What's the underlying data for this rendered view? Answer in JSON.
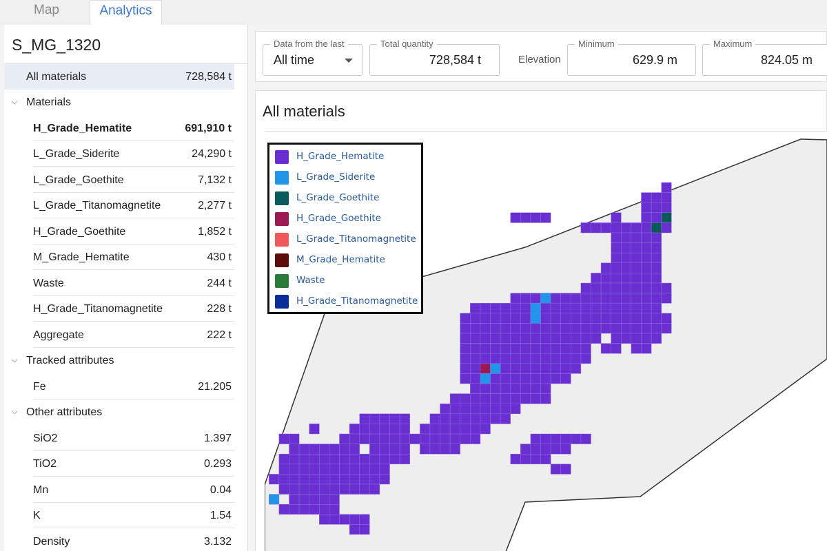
{
  "tabs": [
    {
      "label": "Map",
      "active": false
    },
    {
      "label": "Analytics",
      "active": true
    }
  ],
  "sidebar": {
    "title": "S_MG_1320",
    "all_materials": {
      "label": "All materials",
      "value": "728,584 t"
    },
    "materials_group": {
      "label": "Materials",
      "items": [
        {
          "label": "H_Grade_Hematite",
          "value": "691,910 t"
        },
        {
          "label": "L_Grade_Siderite",
          "value": "24,290 t"
        },
        {
          "label": "L_Grade_Goethite",
          "value": "7,132 t"
        },
        {
          "label": "L_Grade_Titanomagnetite",
          "value": "2,277 t"
        },
        {
          "label": "H_Grade_Goethite",
          "value": "1,852 t"
        },
        {
          "label": "M_Grade_Hematite",
          "value": "430 t"
        },
        {
          "label": "Waste",
          "value": "244 t"
        },
        {
          "label": "H_Grade_Titanomagnetite",
          "value": "228 t"
        },
        {
          "label": "Aggregate",
          "value": "222 t"
        }
      ]
    },
    "tracked_group": {
      "label": "Tracked attributes",
      "items": [
        {
          "label": "Fe",
          "value": "21.205"
        }
      ]
    },
    "other_group": {
      "label": "Other attributes",
      "items": [
        {
          "label": "SiO2",
          "value": "1.397"
        },
        {
          "label": "TiO2",
          "value": "0.293"
        },
        {
          "label": "Mn",
          "value": "0.04"
        },
        {
          "label": "K",
          "value": "1.54"
        },
        {
          "label": "Density",
          "value": "3.132"
        }
      ]
    }
  },
  "filters": {
    "data_from": {
      "legend": "Data from the last",
      "value": "All time"
    },
    "total_quantity": {
      "legend": "Total quantity",
      "value": "728,584 t"
    },
    "elevation_label": "Elevation",
    "minimum": {
      "legend": "Minimum",
      "value": "629.9 m"
    },
    "maximum": {
      "legend": "Maximum",
      "value": "824.05 m"
    }
  },
  "panel": {
    "title": "All materials"
  },
  "legend": [
    {
      "label": "H_Grade_Hematite",
      "color": "#6a2fd0"
    },
    {
      "label": "L_Grade_Siderite",
      "color": "#2196e8"
    },
    {
      "label": "L_Grade_Goethite",
      "color": "#0b5a5a"
    },
    {
      "label": "H_Grade_Goethite",
      "color": "#9b1a55"
    },
    {
      "label": "L_Grade_Titanomagnetite",
      "color": "#f2585a"
    },
    {
      "label": "M_Grade_Hematite",
      "color": "#5c0a0a"
    },
    {
      "label": "Waste",
      "color": "#2a7a3a"
    },
    {
      "label": "H_Grade_Titanomagnetite",
      "color": "#0a2d9a"
    }
  ]
}
